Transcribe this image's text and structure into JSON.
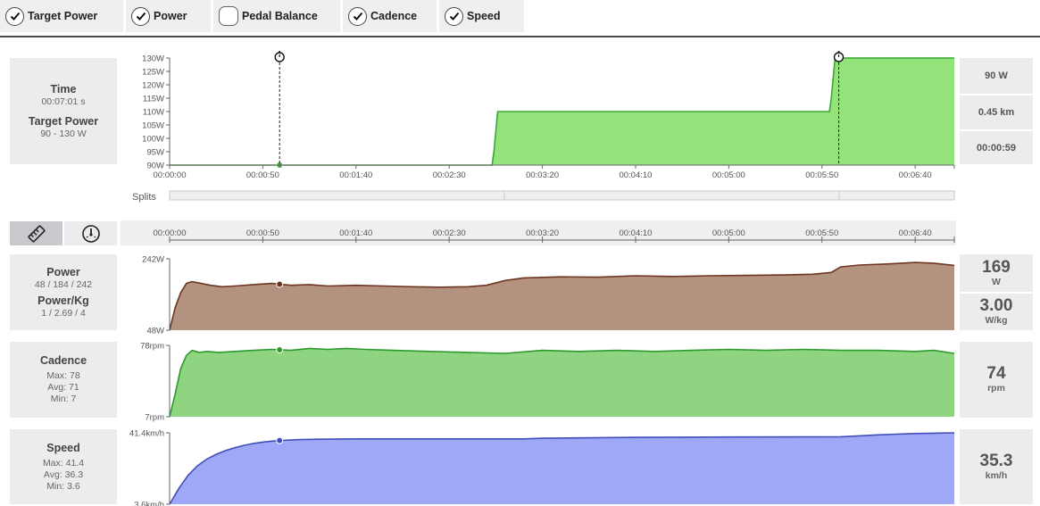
{
  "toggles": [
    {
      "label": "Target Power",
      "checked": true
    },
    {
      "label": "Power",
      "checked": true
    },
    {
      "label": "Pedal Balance",
      "checked": false
    },
    {
      "label": "Cadence",
      "checked": true
    },
    {
      "label": "Speed",
      "checked": true
    }
  ],
  "summary": {
    "time_label": "Time",
    "time_value": "00:07:01 s",
    "target_label": "Target Power",
    "target_value": "90 - 130 W"
  },
  "right_info": {
    "power": "90 W",
    "distance": "0.45 km",
    "time": "00:00:59"
  },
  "splits_label": "Splits",
  "power": {
    "label": "Power",
    "stats": "48 / 184 / 242",
    "pk_label": "Power/Kg",
    "pk_stats": "1 / 2.69 / 4",
    "value": "169",
    "unit": "W",
    "pk_value": "3.00",
    "pk_unit": "W/kg"
  },
  "cadence": {
    "label": "Cadence",
    "max": "Max: 78",
    "avg": "Avg: 71",
    "min": "Min: 7",
    "value": "74",
    "unit": "rpm"
  },
  "speed": {
    "label": "Speed",
    "max": "Max: 41.4",
    "avg": "Avg: 36.3",
    "min": "Min: 3.6",
    "value": "35.3",
    "unit": "km/h"
  },
  "chart_data": [
    {
      "type": "area",
      "title": "",
      "xlabel": "",
      "ylabel": "",
      "xlim": [
        0,
        421
      ],
      "ylim": [
        90,
        130
      ],
      "x_ticks": [
        "00:00:00",
        "00:00:50",
        "00:01:40",
        "00:02:30",
        "00:03:20",
        "00:04:10",
        "00:05:00",
        "00:05:50",
        "00:06:40"
      ],
      "y_ticks": [
        "90W",
        "95W",
        "100W",
        "105W",
        "110W",
        "115W",
        "120W",
        "125W",
        "130W"
      ],
      "series": [
        {
          "color": "#94e27a",
          "line_color": "#3aa832",
          "x": [
            0,
            173,
            174,
            176,
            354,
            355,
            357,
            421
          ],
          "y": [
            90,
            90,
            95,
            110,
            110,
            115,
            130,
            130
          ]
        }
      ],
      "markers": [
        {
          "x": 59,
          "label": "⏱"
        },
        {
          "x": 359,
          "label": "⏱"
        }
      ],
      "current_x": 59,
      "grid": false
    },
    {
      "type": "area",
      "title": "",
      "xlabel": "",
      "ylabel": "",
      "xlim": [
        0,
        421
      ],
      "ylim": [
        48,
        242
      ],
      "x_ticks": [],
      "y_ticks": [
        "48W",
        "242W"
      ],
      "series": [
        {
          "color": "#b49280",
          "line_color": "#6e3620",
          "x": [
            0,
            3,
            6,
            9,
            12,
            16,
            22,
            28,
            35,
            45,
            55,
            65,
            75,
            85,
            100,
            115,
            130,
            145,
            160,
            170,
            180,
            190,
            210,
            230,
            250,
            270,
            290,
            310,
            330,
            345,
            355,
            360,
            370,
            385,
            400,
            410,
            421
          ],
          "y": [
            48,
            110,
            150,
            175,
            180,
            176,
            170,
            166,
            168,
            172,
            175,
            170,
            172,
            168,
            170,
            168,
            166,
            165,
            166,
            170,
            183,
            190,
            193,
            192,
            196,
            194,
            196,
            197,
            198,
            200,
            205,
            220,
            225,
            228,
            232,
            230,
            224
          ]
        }
      ],
      "current_x": 59,
      "grid": false
    },
    {
      "type": "area",
      "title": "",
      "xlabel": "",
      "ylabel": "",
      "xlim": [
        0,
        421
      ],
      "ylim": [
        7,
        78
      ],
      "x_ticks": [],
      "y_ticks": [
        "7rpm",
        "78rpm"
      ],
      "series": [
        {
          "color": "#8fd480",
          "line_color": "#2c9a2c",
          "x": [
            0,
            3,
            6,
            9,
            12,
            16,
            20,
            26,
            35,
            45,
            55,
            65,
            75,
            85,
            95,
            105,
            120,
            140,
            160,
            180,
            200,
            220,
            240,
            260,
            280,
            300,
            320,
            340,
            360,
            380,
            400,
            410,
            421
          ],
          "y": [
            7,
            30,
            55,
            68,
            73,
            71,
            72,
            71,
            72,
            73,
            74,
            73,
            75,
            74,
            75,
            74,
            73,
            72,
            71,
            70,
            73,
            72,
            73,
            72,
            73,
            74,
            73,
            74,
            73,
            73,
            72,
            73,
            70
          ]
        }
      ],
      "current_x": 59,
      "grid": false
    },
    {
      "type": "area",
      "title": "",
      "xlabel": "",
      "ylabel": "",
      "xlim": [
        0,
        421
      ],
      "ylim": [
        3.6,
        41.4
      ],
      "x_ticks": [],
      "y_ticks": [
        "3.6km/h",
        "41.4km/h"
      ],
      "series": [
        {
          "color": "#9ea8f7",
          "line_color": "#3f4ebb",
          "x": [
            0,
            5,
            10,
            15,
            20,
            25,
            30,
            35,
            40,
            45,
            50,
            55,
            60,
            70,
            80,
            100,
            150,
            190,
            200,
            250,
            300,
            360,
            370,
            380,
            390,
            400,
            410,
            421
          ],
          "y": [
            3.6,
            12,
            19,
            24,
            27.5,
            30,
            32,
            33.5,
            34.8,
            35.8,
            36.5,
            37,
            37.4,
            37.8,
            38,
            38.2,
            38.2,
            38.2,
            38.5,
            39,
            39.2,
            39.3,
            39.8,
            40.3,
            40.7,
            41,
            41.2,
            41.4
          ]
        }
      ],
      "current_x": 59,
      "grid": false
    }
  ]
}
